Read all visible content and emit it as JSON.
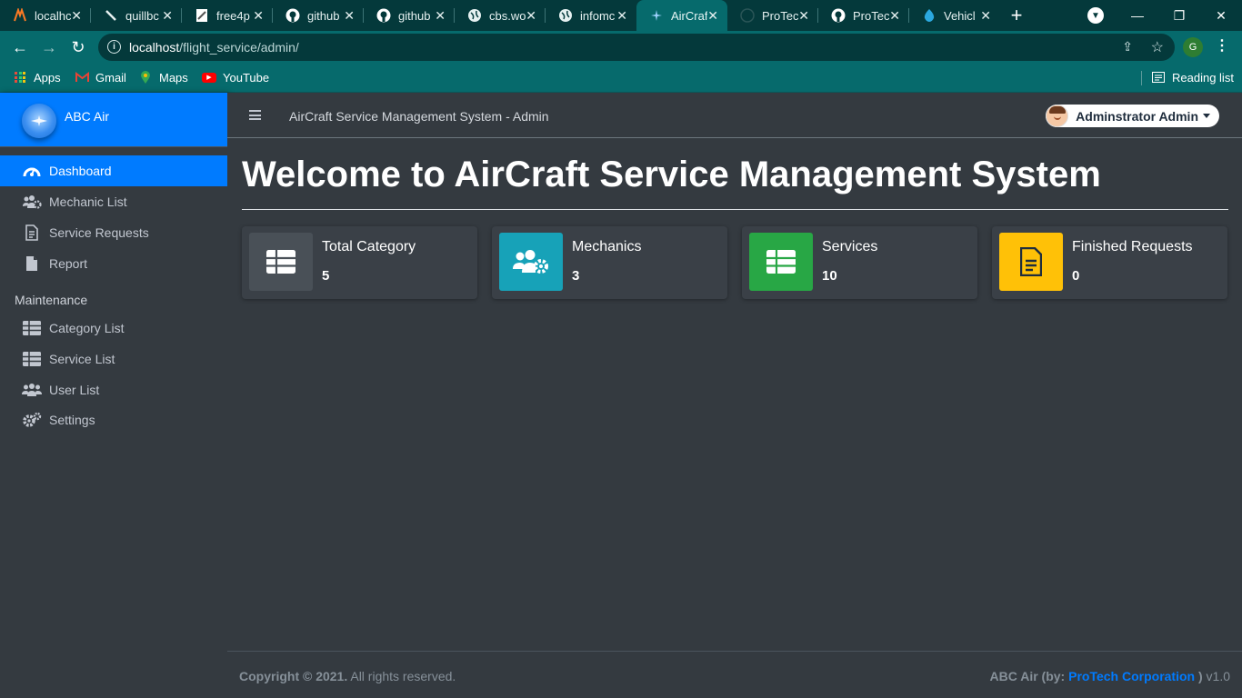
{
  "browser": {
    "tabs": [
      {
        "title": "localhc",
        "icon": "xampp-icon"
      },
      {
        "title": "quillbc",
        "icon": "quill-icon"
      },
      {
        "title": "free4p",
        "icon": "page-icon"
      },
      {
        "title": "github",
        "icon": "github-icon"
      },
      {
        "title": "github",
        "icon": "github-icon"
      },
      {
        "title": "cbs.wo",
        "icon": "globe-icon"
      },
      {
        "title": "infomc",
        "icon": "globe-icon"
      },
      {
        "title": "AirCraf",
        "icon": "aircraft-icon",
        "active": true
      },
      {
        "title": "ProTec",
        "icon": "github-icon"
      },
      {
        "title": "ProTec",
        "icon": "github-icon"
      },
      {
        "title": "Vehicl",
        "icon": "drupal-icon"
      }
    ],
    "url_host": "localhost",
    "url_path": "/flight_service/admin/",
    "profile_initial": "G",
    "bookmarks": {
      "apps": "Apps",
      "gmail": "Gmail",
      "maps": "Maps",
      "youtube": "YouTube",
      "reading_list": "Reading list"
    },
    "colors": {
      "frame": "#04393b",
      "toolbar": "#066a6c"
    }
  },
  "app": {
    "brand_name": "ABC Air",
    "system_title": "AirCraft Service Management System - Admin",
    "user_name": "Adminstrator Admin",
    "colors": {
      "primary": "#007bff",
      "dark": "#343a40",
      "info": "#17a2b8",
      "success": "#28a745",
      "warning": "#ffc107",
      "secondary": "#495057"
    }
  },
  "sidebar": {
    "items": [
      {
        "label": "Dashboard",
        "icon": "tachometer-icon",
        "active": true
      },
      {
        "label": "Mechanic List",
        "icon": "users-cog-icon"
      },
      {
        "label": "Service Requests",
        "icon": "file-list-icon"
      },
      {
        "label": "Report",
        "icon": "file-icon"
      }
    ],
    "section_header": "Maintenance",
    "maintenance_items": [
      {
        "label": "Category List",
        "icon": "table-icon"
      },
      {
        "label": "Service List",
        "icon": "table-icon"
      },
      {
        "label": "User List",
        "icon": "users-icon"
      },
      {
        "label": "Settings",
        "icon": "cogs-icon"
      }
    ]
  },
  "main": {
    "page_title": "Welcome to AirCraft Service Management System",
    "info_boxes": [
      {
        "label": "Total Category",
        "value": "5",
        "icon": "table-icon",
        "color": "#495057"
      },
      {
        "label": "Mechanics",
        "value": "3",
        "icon": "users-cog-icon",
        "color": "#17a2b8"
      },
      {
        "label": "Services",
        "value": "10",
        "icon": "table-icon",
        "color": "#28a745"
      },
      {
        "label": "Finished Requests",
        "value": "0",
        "icon": "file-alt-icon",
        "color": "#ffc107"
      }
    ]
  },
  "footer": {
    "copyright_bold": "Copyright © 2021.",
    "copyright_rest": " All rights reserved.",
    "credit_prefix": "ABC Air (by: ",
    "credit_link": "ProTech Corporation",
    "credit_suffix": " )",
    "version": " v1.0"
  }
}
